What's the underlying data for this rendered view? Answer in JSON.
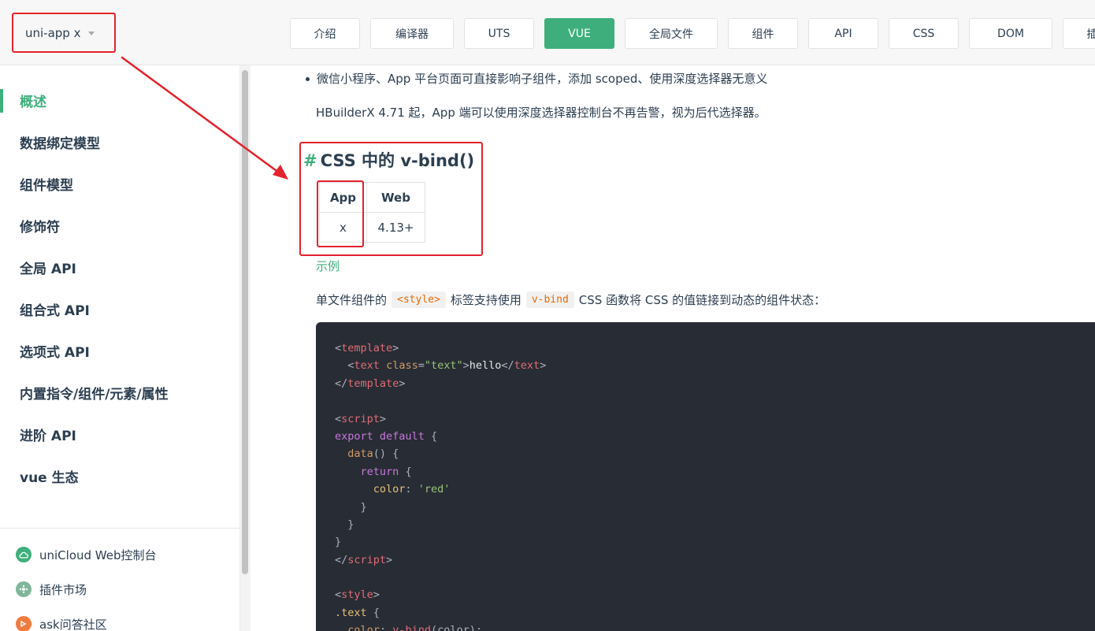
{
  "product": {
    "label": "uni-app x"
  },
  "nav_tabs": [
    {
      "label": "介绍",
      "w": 89
    },
    {
      "label": "编译器",
      "w": 106
    },
    {
      "label": "UTS",
      "w": 89
    },
    {
      "label": "VUE",
      "w": 89
    },
    {
      "label": "全局文件",
      "w": 118
    },
    {
      "label": "组件",
      "w": 89
    },
    {
      "label": "API",
      "w": 89
    },
    {
      "label": "CSS",
      "w": 89
    },
    {
      "label": "DOM",
      "w": 106
    },
    {
      "label": "插件",
      "w": 89
    }
  ],
  "sidebar": {
    "items": [
      {
        "label": "概述",
        "active": true
      },
      {
        "label": "数据绑定模型"
      },
      {
        "label": "组件模型"
      },
      {
        "label": "修饰符"
      },
      {
        "label": "全局 API"
      },
      {
        "label": "组合式 API"
      },
      {
        "label": "选项式 API"
      },
      {
        "label": "内置指令/组件/元素/属性"
      },
      {
        "label": "进阶 API"
      },
      {
        "label": "vue 生态"
      }
    ],
    "links": [
      {
        "label": "uniCloud Web控制台",
        "icon": "cloud-icon",
        "color": "#3eaf7c"
      },
      {
        "label": "插件市场",
        "icon": "plugin-market-icon",
        "color": "#7fb69a"
      },
      {
        "label": "ask问答社区",
        "icon": "ask-community-icon",
        "color": "#f07b3f"
      }
    ]
  },
  "content": {
    "bullet": "微信小程序、App 平台页面可直接影响子组件，添加 scoped、使用深度选择器无意义",
    "para1": "HBuilderX 4.71 起，App 端可以使用深度选择器控制台不再告警，视为后代选择器。",
    "heading_hash": "#",
    "heading": "CSS 中的 v-bind()",
    "table": {
      "headers": [
        "App",
        "Web"
      ],
      "values": [
        "x",
        "4.13+"
      ]
    },
    "example_link": "示例",
    "para2": {
      "before": "单文件组件的",
      "code1": "<style>",
      "middle": "标签支持使用",
      "code2": "v-bind",
      "after": "CSS 函数将 CSS 的值链接到动态的组件状态："
    }
  },
  "colors": {
    "accent": "#3eaf7c",
    "annotation": "#e3222c",
    "code_bg": "#282c34"
  }
}
